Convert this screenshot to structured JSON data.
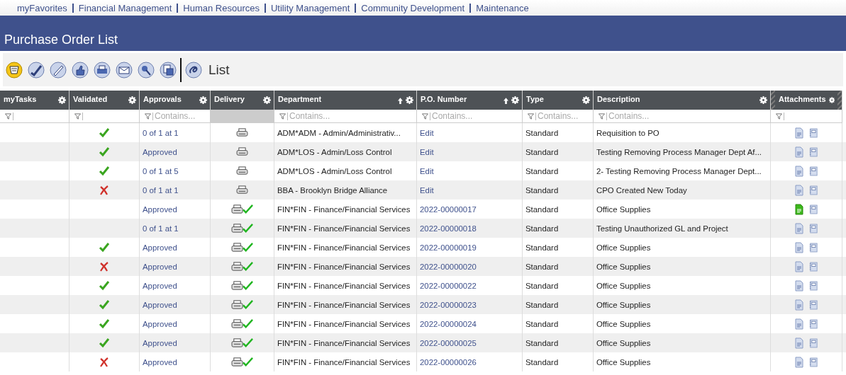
{
  "nav": [
    "myFavorites",
    "Financial Management",
    "Human Resources",
    "Utility Management",
    "Community Development",
    "Maintenance"
  ],
  "title": "Purchase Order List",
  "toolbar": {
    "label": "List"
  },
  "columns": [
    {
      "label": "myTasks",
      "filter_disabled": false,
      "sorted": false
    },
    {
      "label": "Validated",
      "filter_disabled": false,
      "sorted": false
    },
    {
      "label": "Approvals",
      "filter_disabled": false,
      "placeholder": "Contains...",
      "sorted": false
    },
    {
      "label": "Delivery",
      "filter_disabled": true,
      "sorted": false
    },
    {
      "label": "Department",
      "filter_disabled": false,
      "placeholder": "Contains...",
      "sorted": true
    },
    {
      "label": "P.O. Number",
      "filter_disabled": false,
      "placeholder": "Contains...",
      "sorted": true
    },
    {
      "label": "Type",
      "filter_disabled": false,
      "placeholder": "Contains...",
      "sorted": false
    },
    {
      "label": "Description",
      "filter_disabled": false,
      "placeholder": "Contains...",
      "sorted": false
    },
    {
      "label": "Attachments",
      "filter_disabled": false,
      "sorted": false
    }
  ],
  "rows": [
    {
      "validated": true,
      "approvals": "0 of 1 at 1",
      "delivered": false,
      "department": "ADM*ADM - Admin/Administrativ...",
      "po": "Edit",
      "type": "Standard",
      "description": "Requisition to PO",
      "attached": false
    },
    {
      "validated": true,
      "approvals": "Approved",
      "delivered": false,
      "department": "ADM*LOS - Admin/Loss Control",
      "po": "Edit",
      "type": "Standard",
      "description": "Testing Removing Process Manager Dept Af...",
      "attached": false
    },
    {
      "validated": true,
      "approvals": "0 of 1 at 5",
      "delivered": false,
      "department": "ADM*LOS - Admin/Loss Control",
      "po": "Edit",
      "type": "Standard",
      "description": "2- Testing Removing Process Manager Dept...",
      "attached": false
    },
    {
      "validated": false,
      "approvals": "0 of 1 at 1",
      "delivered": false,
      "department": "BBA - Brooklyn Bridge Alliance",
      "po": "Edit",
      "type": "Standard",
      "description": "CPO Created New Today",
      "attached": false
    },
    {
      "validated": null,
      "approvals": "Approved",
      "delivered": true,
      "department": "FIN*FIN - Finance/Financial Services",
      "po": "2022-00000017",
      "type": "Standard",
      "description": "Office Supplies",
      "attached": true
    },
    {
      "validated": null,
      "approvals": "0 of 1 at 1",
      "delivered": true,
      "department": "FIN*FIN - Finance/Financial Services",
      "po": "2022-00000018",
      "type": "Standard",
      "description": "Testing Unauthorized GL and Project",
      "attached": false
    },
    {
      "validated": true,
      "approvals": "Approved",
      "delivered": true,
      "department": "FIN*FIN - Finance/Financial Services",
      "po": "2022-00000019",
      "type": "Standard",
      "description": "Office Supplies",
      "attached": false
    },
    {
      "validated": false,
      "approvals": "Approved",
      "delivered": true,
      "department": "FIN*FIN - Finance/Financial Services",
      "po": "2022-00000020",
      "type": "Standard",
      "description": "Office Supplies",
      "attached": false
    },
    {
      "validated": true,
      "approvals": "Approved",
      "delivered": true,
      "department": "FIN*FIN - Finance/Financial Services",
      "po": "2022-00000022",
      "type": "Standard",
      "description": "Office Supplies",
      "attached": false
    },
    {
      "validated": true,
      "approvals": "Approved",
      "delivered": true,
      "department": "FIN*FIN - Finance/Financial Services",
      "po": "2022-00000023",
      "type": "Standard",
      "description": "Office Supplies",
      "attached": false
    },
    {
      "validated": true,
      "approvals": "Approved",
      "delivered": true,
      "department": "FIN*FIN - Finance/Financial Services",
      "po": "2022-00000024",
      "type": "Standard",
      "description": "Office Supplies",
      "attached": false
    },
    {
      "validated": true,
      "approvals": "Approved",
      "delivered": true,
      "department": "FIN*FIN - Finance/Financial Services",
      "po": "2022-00000025",
      "type": "Standard",
      "description": "Office Supplies",
      "attached": false
    },
    {
      "validated": false,
      "approvals": "Approved",
      "delivered": true,
      "department": "FIN*FIN - Finance/Financial Services",
      "po": "2022-00000026",
      "type": "Standard",
      "description": "Office Supplies",
      "attached": false
    }
  ]
}
